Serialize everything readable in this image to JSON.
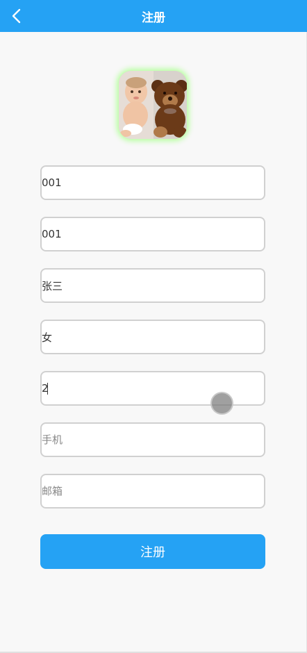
{
  "header": {
    "title": "注册",
    "back_icon": "chevron-left-icon"
  },
  "avatar": {
    "description_icon": "avatar-image"
  },
  "form": {
    "account": {
      "value": "001",
      "placeholder": ""
    },
    "password": {
      "value": "001",
      "placeholder": ""
    },
    "name": {
      "value": "张三",
      "placeholder": ""
    },
    "gender": {
      "value": "女",
      "placeholder": ""
    },
    "age": {
      "value": "2",
      "placeholder": ""
    },
    "phone": {
      "value": "",
      "placeholder": "手机"
    },
    "email": {
      "value": "",
      "placeholder": "邮箱"
    }
  },
  "submit": {
    "label": "注册"
  },
  "colors": {
    "primary": "#25a2f4",
    "avatar_glow": "#b6ff9e",
    "background": "#f8f8f8"
  }
}
